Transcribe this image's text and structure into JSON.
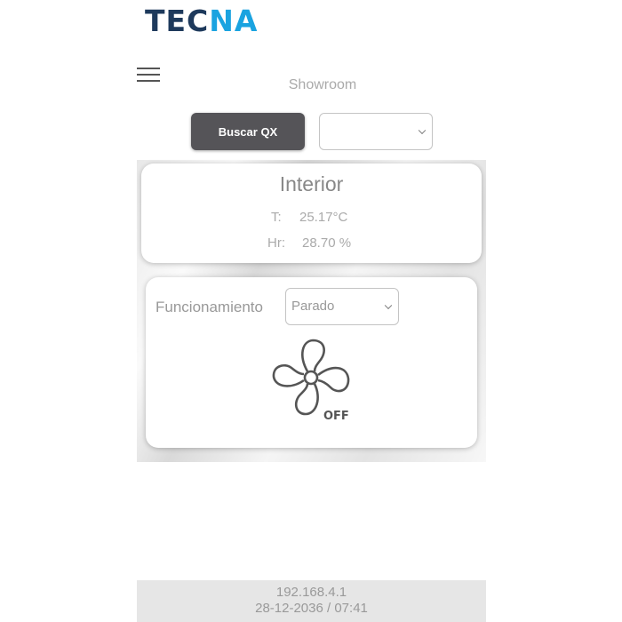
{
  "header": {
    "logo_part1": "TEC",
    "logo_part2": "NA",
    "location": "Showroom"
  },
  "toolbar": {
    "search_button_label": "Buscar QX",
    "qx_select_value": ""
  },
  "interior": {
    "title": "Interior",
    "temp_label": "T:",
    "temp_value": "25.17°C",
    "humidity_label": "Hr:",
    "humidity_value": "28.70 %"
  },
  "operation": {
    "label": "Funcionamiento",
    "selected_mode": "Parado",
    "fan_state": "OFF"
  },
  "footer": {
    "ip": "192.168.4.1",
    "datetime": "28-12-2036 / 07:41"
  },
  "colors": {
    "logo_dark": "#1e3a5c",
    "logo_accent": "#1aa3e0",
    "button_bg": "#555458"
  },
  "icons": [
    "hamburger-menu-icon",
    "chevron-down-icon",
    "fan-icon"
  ]
}
